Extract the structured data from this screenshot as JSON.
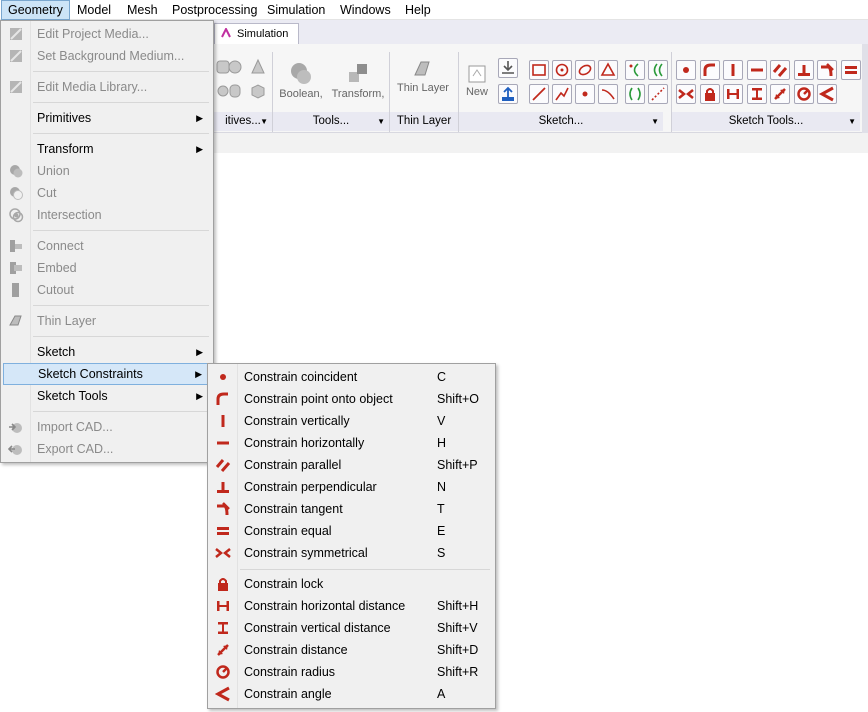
{
  "menubar": {
    "items": [
      {
        "label": "Geometry",
        "active": true
      },
      {
        "label": "Model"
      },
      {
        "label": "Mesh"
      },
      {
        "label": "Postprocessing"
      },
      {
        "label": "Simulation"
      },
      {
        "label": "Windows"
      },
      {
        "label": "Help"
      }
    ]
  },
  "ribbon": {
    "tab_label": "Simulation",
    "boolean_label": "Boolean,",
    "transform_label": "Transform,",
    "thin_layer_btn": "Thin Layer",
    "new_label": "New",
    "groups": {
      "primitives": "itives...",
      "tools": "Tools...",
      "thin_layer": "Thin Layer",
      "sketch": "Sketch...",
      "sketch_tools": "Sketch Tools..."
    }
  },
  "geometry_menu": {
    "items": [
      {
        "label": "Edit Project Media...",
        "disabled": true,
        "icon": "edit-media-icon"
      },
      {
        "label": "Set Background Medium...",
        "disabled": true,
        "icon": "background-medium-icon"
      },
      {
        "label": "Edit Media Library...",
        "disabled": true,
        "icon": "media-library-icon"
      },
      {
        "label": "Primitives",
        "submenu": true
      },
      {
        "label": "Transform",
        "submenu": true
      },
      {
        "label": "Union",
        "disabled": true,
        "icon": "union-icon"
      },
      {
        "label": "Cut",
        "disabled": true,
        "icon": "cut-icon"
      },
      {
        "label": "Intersection",
        "disabled": true,
        "icon": "intersection-icon"
      },
      {
        "label": "Connect",
        "disabled": true,
        "icon": "connect-icon"
      },
      {
        "label": "Embed",
        "disabled": true,
        "icon": "embed-icon"
      },
      {
        "label": "Cutout",
        "disabled": true,
        "icon": "cutout-icon"
      },
      {
        "label": "Thin Layer",
        "disabled": true,
        "icon": "thin-layer-icon"
      },
      {
        "label": "Sketch",
        "submenu": true
      },
      {
        "label": "Sketch Constraints",
        "submenu": true,
        "highlighted": true
      },
      {
        "label": "Sketch Tools",
        "submenu": true
      },
      {
        "label": "Import CAD...",
        "disabled": true,
        "icon": "import-cad-icon"
      },
      {
        "label": "Export CAD...",
        "disabled": true,
        "icon": "export-cad-icon"
      }
    ]
  },
  "constraints_menu": {
    "accent_color": "#c0281c",
    "items": [
      {
        "label": "Constrain coincident",
        "shortcut": "C",
        "icon": "coincident-icon"
      },
      {
        "label": "Constrain point onto object",
        "shortcut": "Shift+O",
        "icon": "point-on-object-icon"
      },
      {
        "label": "Constrain vertically",
        "shortcut": "V",
        "icon": "vertical-icon"
      },
      {
        "label": "Constrain horizontally",
        "shortcut": "H",
        "icon": "horizontal-icon"
      },
      {
        "label": "Constrain parallel",
        "shortcut": "Shift+P",
        "icon": "parallel-icon"
      },
      {
        "label": "Constrain perpendicular",
        "shortcut": "N",
        "icon": "perpendicular-icon"
      },
      {
        "label": "Constrain tangent",
        "shortcut": "T",
        "icon": "tangent-icon"
      },
      {
        "label": "Constrain equal",
        "shortcut": "E",
        "icon": "equal-icon"
      },
      {
        "label": "Constrain symmetrical",
        "shortcut": "S",
        "icon": "symmetrical-icon"
      },
      {
        "label": "Constrain lock",
        "shortcut": "",
        "icon": "lock-icon"
      },
      {
        "label": "Constrain horizontal distance",
        "shortcut": "Shift+H",
        "icon": "horizontal-distance-icon"
      },
      {
        "label": "Constrain vertical distance",
        "shortcut": "Shift+V",
        "icon": "vertical-distance-icon"
      },
      {
        "label": "Constrain distance",
        "shortcut": "Shift+D",
        "icon": "distance-icon"
      },
      {
        "label": "Constrain radius",
        "shortcut": "Shift+R",
        "icon": "radius-icon"
      },
      {
        "label": "Constrain angle",
        "shortcut": "A",
        "icon": "angle-icon"
      }
    ]
  }
}
